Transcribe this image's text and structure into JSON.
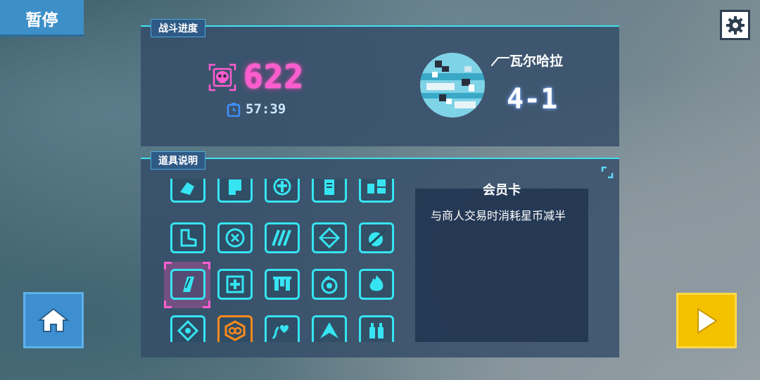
{
  "pause_tab": {
    "label": "暂停"
  },
  "settings": {
    "icon": "gear-icon"
  },
  "battle_progress": {
    "label": "战斗进度",
    "score": "622",
    "score_icon": "skull-target-icon",
    "timer_icon": "stopwatch-icon",
    "time": "57:39",
    "planet_name": "瓦尔哈拉",
    "level": "4-1",
    "colors": {
      "score": "#ff5cd0",
      "accent": "#3fe0f0"
    }
  },
  "item_info": {
    "label": "道具说明",
    "selected_title": "会员卡",
    "selected_description": "与商人交易时消耗星币减半",
    "collapse_icon": "corner-toggle-icon",
    "items": [
      {
        "icon": "hand-icon"
      },
      {
        "icon": "armor-icon"
      },
      {
        "icon": "cross-coin-icon"
      },
      {
        "icon": "scroll-icon"
      },
      {
        "icon": "pieces-icon"
      },
      {
        "icon": "boot-icon"
      },
      {
        "icon": "cancel-circle-icon"
      },
      {
        "icon": "stripes-icon"
      },
      {
        "icon": "diamond-icon"
      },
      {
        "icon": "no-weapon-face-icon"
      },
      {
        "icon": "member-card-icon"
      },
      {
        "icon": "medkit-icon"
      },
      {
        "icon": "banner-icon"
      },
      {
        "icon": "potion-icon"
      },
      {
        "icon": "fire-icon"
      },
      {
        "icon": "target-icon"
      },
      {
        "icon": "infinity-badge-icon"
      },
      {
        "icon": "heart-path-icon"
      },
      {
        "icon": "triangle-wing-icon"
      },
      {
        "icon": "bottles-icon"
      }
    ],
    "selected_index": 10
  },
  "home_button": {
    "icon": "home-icon"
  },
  "play_button": {
    "icon": "play-icon"
  }
}
